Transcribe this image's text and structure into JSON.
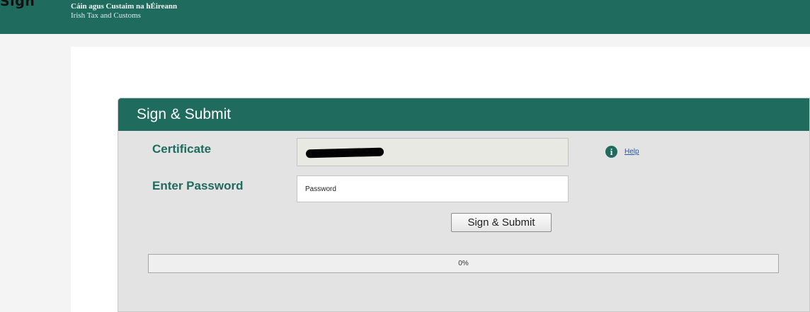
{
  "page": {
    "top_caption": "Sign"
  },
  "banner": {
    "irish_name": "Cáin agus Custaim na hÉireann",
    "english_name": "Irish Tax and Customs"
  },
  "panel": {
    "title": "Sign & Submit",
    "certificate_label": "Certificate",
    "password_label": "Enter Password",
    "password_placeholder": "Password",
    "password_value": "",
    "help_label": "Help",
    "submit_label": "Sign & Submit",
    "progress_text": "0%",
    "progress_fraction": 0
  },
  "colors": {
    "brand_green": "#1f6b5e",
    "panel_background": "#e3e3e3",
    "label_color": "#1f6b5e",
    "link_color": "#2457a6"
  },
  "icons": {
    "help": "info-icon"
  }
}
